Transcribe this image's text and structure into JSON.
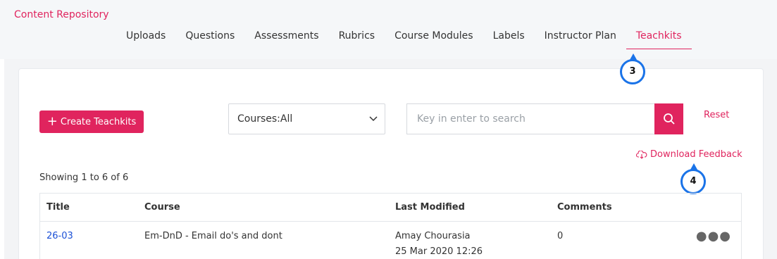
{
  "header": {
    "title": "Content Repository",
    "tabs": [
      {
        "label": "Uploads"
      },
      {
        "label": "Questions"
      },
      {
        "label": "Assessments"
      },
      {
        "label": "Rubrics"
      },
      {
        "label": "Course Modules"
      },
      {
        "label": "Labels"
      },
      {
        "label": "Instructor Plan"
      },
      {
        "label": "Teachkits",
        "active": true
      }
    ]
  },
  "callouts": {
    "tab": "3",
    "download": "4"
  },
  "toolbar": {
    "create_label": "Create Teachkits",
    "course_filter": "Courses:All",
    "search_placeholder": "Key in enter to search",
    "reset_label": "Reset",
    "download_label": "Download Feedback"
  },
  "summary": "Showing 1 to 6 of 6",
  "table": {
    "columns": [
      "Title",
      "Course",
      "Last Modified",
      "Comments"
    ],
    "rows": [
      {
        "title": "26-03",
        "course": "Em-DnD - Email do's and dont",
        "modified_by": "Amay Chourasia",
        "modified_at": "25 Mar 2020 12:26",
        "comments": "0"
      }
    ]
  },
  "colors": {
    "accent": "#e0245e",
    "callout": "#1a73e8",
    "link": "#1a4fd6"
  }
}
